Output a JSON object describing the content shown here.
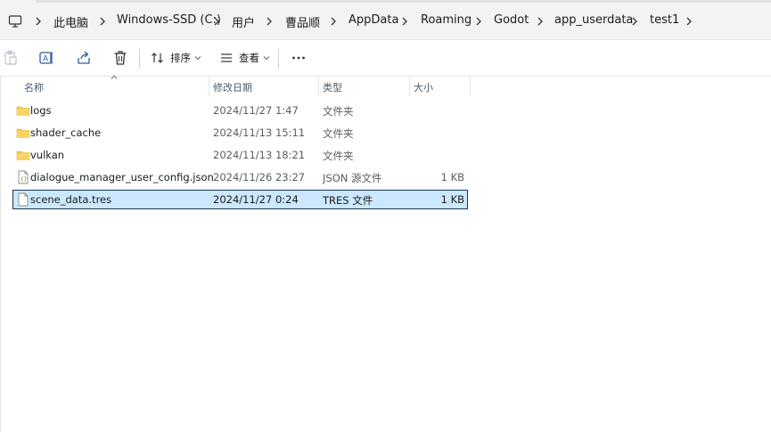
{
  "breadcrumb": {
    "items": [
      "此电脑",
      "Windows-SSD (C:)",
      "用户",
      "曹品顺",
      "AppData",
      "Roaming",
      "Godot",
      "app_userdata",
      "test1"
    ]
  },
  "toolbar": {
    "sort_label": "排序",
    "view_label": "查看"
  },
  "columns": {
    "name": "名称",
    "date": "修改日期",
    "type": "类型",
    "size": "大小"
  },
  "files": [
    {
      "name": "logs",
      "date": "2024/11/27 1:47",
      "type": "文件夹",
      "size": "",
      "icon": "folder-icon"
    },
    {
      "name": "shader_cache",
      "date": "2024/11/13 15:11",
      "type": "文件夹",
      "size": "",
      "icon": "folder-icon"
    },
    {
      "name": "vulkan",
      "date": "2024/11/13 18:21",
      "type": "文件夹",
      "size": "",
      "icon": "folder-icon"
    },
    {
      "name": "dialogue_manager_user_config.json",
      "date": "2024/11/26 23:27",
      "type": "JSON 源文件",
      "size": "1 KB",
      "icon": "json-file-icon"
    },
    {
      "name": "scene_data.tres",
      "date": "2024/11/27 0:24",
      "type": "TRES 文件",
      "size": "1 KB",
      "icon": "file-icon",
      "selected": true
    }
  ],
  "colors": {
    "folder": "#f2c94c",
    "selection": "#cce8ff",
    "selection_border": "#1f3550"
  }
}
